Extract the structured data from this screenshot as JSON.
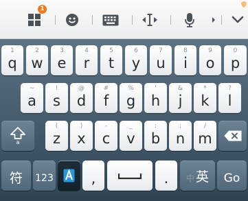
{
  "toolbar": {
    "icons": [
      "apps-icon",
      "emoji-icon",
      "keyboard-icon",
      "cursor-icon",
      "microphone-icon",
      "collapse-chevron-icon"
    ],
    "apps_badge": "1",
    "accent_color": "#f07a1a"
  },
  "rows": {
    "row1": [
      {
        "hint": "1",
        "label": "q"
      },
      {
        "hint": "2",
        "label": "w"
      },
      {
        "hint": "3",
        "label": "e"
      },
      {
        "hint": "4",
        "label": "r"
      },
      {
        "hint": "5",
        "label": "t"
      },
      {
        "hint": "6",
        "label": "y"
      },
      {
        "hint": "7",
        "label": "u"
      },
      {
        "hint": "8",
        "label": "i"
      },
      {
        "hint": "9",
        "label": "o"
      },
      {
        "hint": "0",
        "label": "p"
      }
    ],
    "row2": [
      {
        "hint": "~",
        "label": "a"
      },
      {
        "hint": "!",
        "label": "s"
      },
      {
        "hint": "@",
        "label": "d"
      },
      {
        "hint": "#",
        "label": "f"
      },
      {
        "hint": "%",
        "label": "g"
      },
      {
        "hint": "'",
        "label": "h"
      },
      {
        "hint": "&",
        "label": "j"
      },
      {
        "hint": "*",
        "label": "k"
      },
      {
        "hint": "?",
        "label": "l"
      }
    ],
    "row3": [
      {
        "hint": "(",
        "label": "z"
      },
      {
        "hint": ")",
        "label": "x"
      },
      {
        "hint": "-",
        "label": "c"
      },
      {
        "hint": "_",
        "label": "v"
      },
      {
        "hint": ":",
        "label": "b"
      },
      {
        "hint": ";",
        "label": "n"
      },
      {
        "hint": "/",
        "label": "m"
      }
    ]
  },
  "bottom": {
    "symbols_label": "符",
    "numbers_label": "123",
    "comma_label": ",",
    "period_label": ".",
    "lang_small": "中",
    "lang_big": "英",
    "go_label": "Go"
  }
}
